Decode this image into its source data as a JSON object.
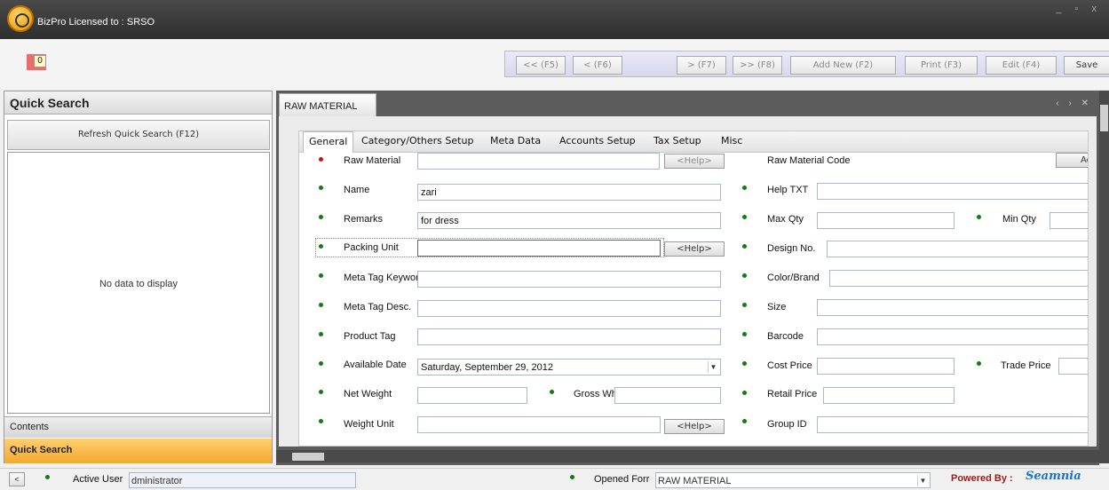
{
  "app": {
    "title": "BizPro Licensed to : SRSO",
    "window_controls": "_ ▫ x"
  },
  "counter": {
    "value": "0"
  },
  "toolbar": {
    "first": "<< (F5)",
    "prev": "< (F6)",
    "next": "> (F7)",
    "last": ">> (F8)",
    "add_new": "Add New (F2)",
    "print": "Print (F3)",
    "edit": "Edit (F4)",
    "save": "Save"
  },
  "left_panel": {
    "title": "Quick Search",
    "refresh": "Refresh Quick Search (F12)",
    "empty_text": "No data to display",
    "contents": "Contents",
    "quick_search": "Quick Search"
  },
  "doc": {
    "tab": "RAW MATERIAL",
    "controls": "‹ › ✕",
    "tabs": [
      "General",
      "Category/Others Setup",
      "Meta Data",
      "Accounts Setup",
      "Tax Setup",
      "Misc"
    ]
  },
  "form": {
    "help": "<Help>",
    "add": "Ad",
    "raw_material": {
      "label": "Raw Material",
      "value": ""
    },
    "name": {
      "label": "Name",
      "value": "zari"
    },
    "remarks": {
      "label": "Remarks",
      "value": "for dress"
    },
    "packing_unit": {
      "label": "Packing Unit",
      "value": ""
    },
    "meta_tag_keyword": {
      "label": "Meta Tag Keyword",
      "value": ""
    },
    "meta_tag_desc": {
      "label": "Meta Tag Desc.",
      "value": ""
    },
    "product_tag": {
      "label": "Product Tag",
      "value": ""
    },
    "available_date": {
      "label": "Available Date",
      "value": "Saturday, September 29, 2012"
    },
    "net_weight": {
      "label": "Net Weight",
      "value": ""
    },
    "gross_wht": {
      "label": "Gross Wht",
      "value": ""
    },
    "weight_unit": {
      "label": "Weight Unit",
      "value": ""
    },
    "raw_material_code": {
      "label": "Raw Material Code"
    },
    "help_txt": {
      "label": "Help TXT",
      "value": ""
    },
    "max_qty": {
      "label": "Max Qty",
      "value": ""
    },
    "min_qty": {
      "label": "Min Qty",
      "value": ""
    },
    "design_no": {
      "label": "Design No.",
      "value": ""
    },
    "color_brand": {
      "label": "Color/Brand",
      "value": ""
    },
    "size": {
      "label": "Size",
      "value": ""
    },
    "barcode": {
      "label": "Barcode",
      "value": ""
    },
    "cost_price": {
      "label": "Cost Price",
      "value": ""
    },
    "trade_price": {
      "label": "Trade Price",
      "value": ""
    },
    "retail_price": {
      "label": "Retail Price",
      "value": ""
    },
    "group_id": {
      "label": "Group ID",
      "value": ""
    }
  },
  "status": {
    "back": "<",
    "active_user_label": "Active User",
    "active_user_value": "dministrator",
    "opened_form_label": "Opened Forr",
    "opened_form_value": "RAW MATERIAL",
    "powered_by": "Powered By :",
    "brand": "Seamnia"
  },
  "colors": {
    "required_dot": "#cc1010",
    "ok_dot": "#137a13",
    "active_panel": "#f4a92d",
    "brand": "#1a73c9"
  }
}
